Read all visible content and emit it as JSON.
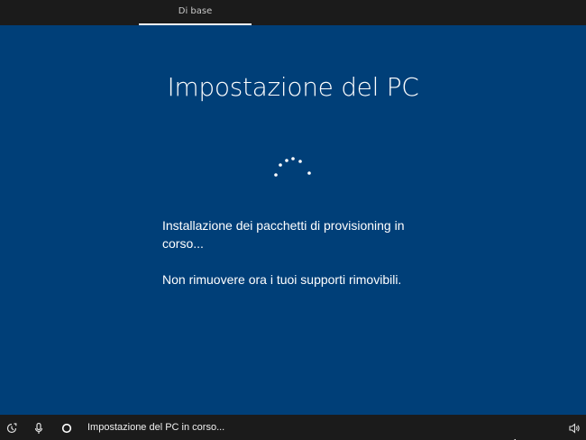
{
  "header": {
    "tab_label": "Di base"
  },
  "main": {
    "title": "Impostazione del PC",
    "message_line1": "Installazione dei pacchetti di provisioning in corso...",
    "message_line2": "Non rimuovere ora i tuoi supporti rimovibili."
  },
  "taskbar": {
    "status_text": "Impostazione del PC in corso...",
    "icons": [
      "accessibility-icon",
      "microphone-icon",
      "cortana-icon",
      "volume-icon"
    ]
  },
  "colors": {
    "background": "#003f78",
    "bar": "#1b1b1b",
    "text": "#ffffff"
  }
}
